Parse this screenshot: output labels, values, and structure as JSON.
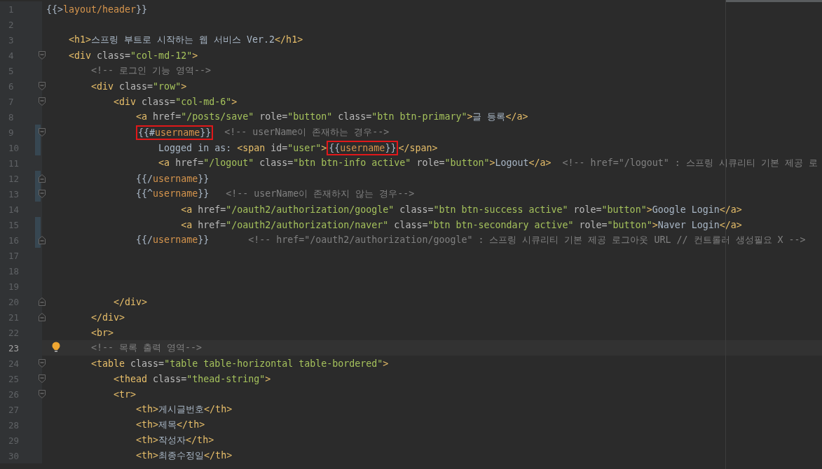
{
  "editor": {
    "lines": [
      {
        "number": "1",
        "tokens": [
          {
            "kind": "mustache",
            "open": "{{>",
            "name": "layout/header",
            "close": "}}",
            "boxed": false
          }
        ]
      },
      {
        "number": "2"
      },
      {
        "number": "3",
        "tokens": [
          {
            "kind": "tag",
            "text": "    <h1>"
          },
          {
            "kind": "text",
            "text": "스프링 부트로 시작하는 웹 서비스 Ver.2"
          },
          {
            "kind": "tag",
            "text": "</h1>"
          }
        ]
      },
      {
        "number": "4",
        "fold_open": true,
        "tokens": [
          {
            "kind": "tag",
            "text": "    <div "
          },
          {
            "kind": "attr",
            "text": "class="
          },
          {
            "kind": "str",
            "text": "\"col-md-12\""
          },
          {
            "kind": "tag",
            "text": ">"
          }
        ]
      },
      {
        "number": "5",
        "tokens": [
          {
            "kind": "comment",
            "text": "        <!-- 로그인 기능 영역-->"
          }
        ]
      },
      {
        "number": "6",
        "fold_open": true,
        "tokens": [
          {
            "kind": "tag",
            "text": "        <div "
          },
          {
            "kind": "attr",
            "text": "class="
          },
          {
            "kind": "str",
            "text": "\"row\""
          },
          {
            "kind": "tag",
            "text": ">"
          }
        ]
      },
      {
        "number": "7",
        "fold_open": true,
        "tokens": [
          {
            "kind": "tag",
            "text": "            <div "
          },
          {
            "kind": "attr",
            "text": "class="
          },
          {
            "kind": "str",
            "text": "\"col-md-6\""
          },
          {
            "kind": "tag",
            "text": ">"
          }
        ]
      },
      {
        "number": "8",
        "tokens": [
          {
            "kind": "tag",
            "text": "                <a "
          },
          {
            "kind": "attr",
            "text": "href="
          },
          {
            "kind": "str",
            "text": "\"/posts/save\""
          },
          {
            "kind": "attr",
            "text": " role="
          },
          {
            "kind": "str",
            "text": "\"button\""
          },
          {
            "kind": "attr",
            "text": " class="
          },
          {
            "kind": "str",
            "text": "\"btn btn-primary\""
          },
          {
            "kind": "tag",
            "text": ">"
          },
          {
            "kind": "text",
            "text": "글 등록"
          },
          {
            "kind": "tag",
            "text": "</a>"
          }
        ]
      },
      {
        "number": "9",
        "fold_open": true,
        "changed": true,
        "tokens": [
          {
            "kind": "mustache",
            "open": "                {{#",
            "name": "username",
            "close": "}}",
            "boxed": true
          },
          {
            "kind": "comment",
            "text": "  <!-- userName이 존재하는 경우-->"
          }
        ]
      },
      {
        "number": "10",
        "changed": true,
        "tokens": [
          {
            "kind": "text",
            "text": "                    Logged in as: "
          },
          {
            "kind": "tag",
            "text": "<span "
          },
          {
            "kind": "attr",
            "text": "id="
          },
          {
            "kind": "str",
            "text": "\"user\""
          },
          {
            "kind": "tag",
            "text": ">"
          },
          {
            "kind": "mustache",
            "open": "{{",
            "name": "username",
            "close": "}}",
            "boxed": true
          },
          {
            "kind": "tag",
            "text": "</span>"
          }
        ]
      },
      {
        "number": "11",
        "tokens": [
          {
            "kind": "tag",
            "text": "                    <a "
          },
          {
            "kind": "attr",
            "text": "href="
          },
          {
            "kind": "str",
            "text": "\"/logout\""
          },
          {
            "kind": "attr",
            "text": " class="
          },
          {
            "kind": "str",
            "text": "\"btn btn-info active\""
          },
          {
            "kind": "attr",
            "text": " role="
          },
          {
            "kind": "str",
            "text": "\"button\""
          },
          {
            "kind": "tag",
            "text": ">"
          },
          {
            "kind": "text",
            "text": "Logout"
          },
          {
            "kind": "tag",
            "text": "</a>"
          },
          {
            "kind": "comment",
            "text": "  <!-- href=\"/logout\" : 스프링 시큐리티 기본 제공 로"
          }
        ]
      },
      {
        "number": "12",
        "fold_close": true,
        "changed": true,
        "tokens": [
          {
            "kind": "mustache",
            "open": "                {{/",
            "name": "username",
            "close": "}}",
            "boxed": false
          }
        ]
      },
      {
        "number": "13",
        "fold_open": true,
        "changed": true,
        "tokens": [
          {
            "kind": "mustache",
            "open": "                {{^",
            "name": "username",
            "close": "}}",
            "boxed": false
          },
          {
            "kind": "comment",
            "text": "   <!-- userName이 존재하지 않는 경우-->"
          }
        ]
      },
      {
        "number": "14",
        "tokens": [
          {
            "kind": "tag",
            "text": "                        <a "
          },
          {
            "kind": "attr",
            "text": "href="
          },
          {
            "kind": "str",
            "text": "\"/oauth2/authorization/google\""
          },
          {
            "kind": "attr",
            "text": " class="
          },
          {
            "kind": "str",
            "text": "\"btn btn-success active\""
          },
          {
            "kind": "attr",
            "text": " role="
          },
          {
            "kind": "str",
            "text": "\"button\""
          },
          {
            "kind": "tag",
            "text": ">"
          },
          {
            "kind": "text",
            "text": "Google Login"
          },
          {
            "kind": "tag",
            "text": "</a>"
          }
        ]
      },
      {
        "number": "15",
        "changed": true,
        "tokens": [
          {
            "kind": "tag",
            "text": "                        <a "
          },
          {
            "kind": "attr",
            "text": "href="
          },
          {
            "kind": "str",
            "text": "\"/oauth2/authorization/naver\""
          },
          {
            "kind": "attr",
            "text": " class="
          },
          {
            "kind": "str",
            "text": "\"btn btn-secondary active\""
          },
          {
            "kind": "attr",
            "text": " role="
          },
          {
            "kind": "str",
            "text": "\"button\""
          },
          {
            "kind": "tag",
            "text": ">"
          },
          {
            "kind": "text",
            "text": "Naver Login"
          },
          {
            "kind": "tag",
            "text": "</a>"
          }
        ]
      },
      {
        "number": "16",
        "fold_close": true,
        "changed": true,
        "tokens": [
          {
            "kind": "mustache",
            "open": "                {{/",
            "name": "username",
            "close": "}}",
            "boxed": false
          },
          {
            "kind": "comment",
            "text": "       <!-- href=\"/oauth2/authorization/google\" : 스프링 시큐리티 기본 제공 로그아웃 URL // 컨트롤러 생성필요 X -->"
          }
        ]
      },
      {
        "number": "17"
      },
      {
        "number": "18"
      },
      {
        "number": "19"
      },
      {
        "number": "20",
        "fold_close": true,
        "tokens": [
          {
            "kind": "tag",
            "text": "            </div>"
          }
        ]
      },
      {
        "number": "21",
        "fold_close": true,
        "tokens": [
          {
            "kind": "tag",
            "text": "        </div>"
          }
        ]
      },
      {
        "number": "22",
        "tokens": [
          {
            "kind": "tag",
            "text": "        <br>"
          }
        ]
      },
      {
        "number": "23",
        "current": true,
        "bulb": true,
        "tokens": [
          {
            "kind": "comment",
            "text": "        <!-- 목록 출력 영역-->"
          }
        ]
      },
      {
        "number": "24",
        "fold_open": true,
        "tokens": [
          {
            "kind": "tag",
            "text": "        <table "
          },
          {
            "kind": "attr",
            "text": "class="
          },
          {
            "kind": "str",
            "text": "\"table table-horizontal table-bordered\""
          },
          {
            "kind": "tag",
            "text": ">"
          }
        ]
      },
      {
        "number": "25",
        "fold_open": true,
        "tokens": [
          {
            "kind": "tag",
            "text": "            <thead "
          },
          {
            "kind": "attr",
            "text": "class="
          },
          {
            "kind": "str",
            "text": "\"thead-string\""
          },
          {
            "kind": "tag",
            "text": ">"
          }
        ]
      },
      {
        "number": "26",
        "fold_open": true,
        "tokens": [
          {
            "kind": "tag",
            "text": "            <tr>"
          }
        ]
      },
      {
        "number": "27",
        "tokens": [
          {
            "kind": "tag",
            "text": "                <th>"
          },
          {
            "kind": "text",
            "text": "게시글번호"
          },
          {
            "kind": "tag",
            "text": "</th>"
          }
        ]
      },
      {
        "number": "28",
        "tokens": [
          {
            "kind": "tag",
            "text": "                <th>"
          },
          {
            "kind": "text",
            "text": "제목"
          },
          {
            "kind": "tag",
            "text": "</th>"
          }
        ]
      },
      {
        "number": "29",
        "tokens": [
          {
            "kind": "tag",
            "text": "                <th>"
          },
          {
            "kind": "text",
            "text": "작성자"
          },
          {
            "kind": "tag",
            "text": "</th>"
          }
        ]
      },
      {
        "number": "30",
        "tokens": [
          {
            "kind": "tag",
            "text": "                <th>"
          },
          {
            "kind": "text",
            "text": "최종수정일"
          },
          {
            "kind": "tag",
            "text": "</th>"
          }
        ]
      }
    ]
  }
}
